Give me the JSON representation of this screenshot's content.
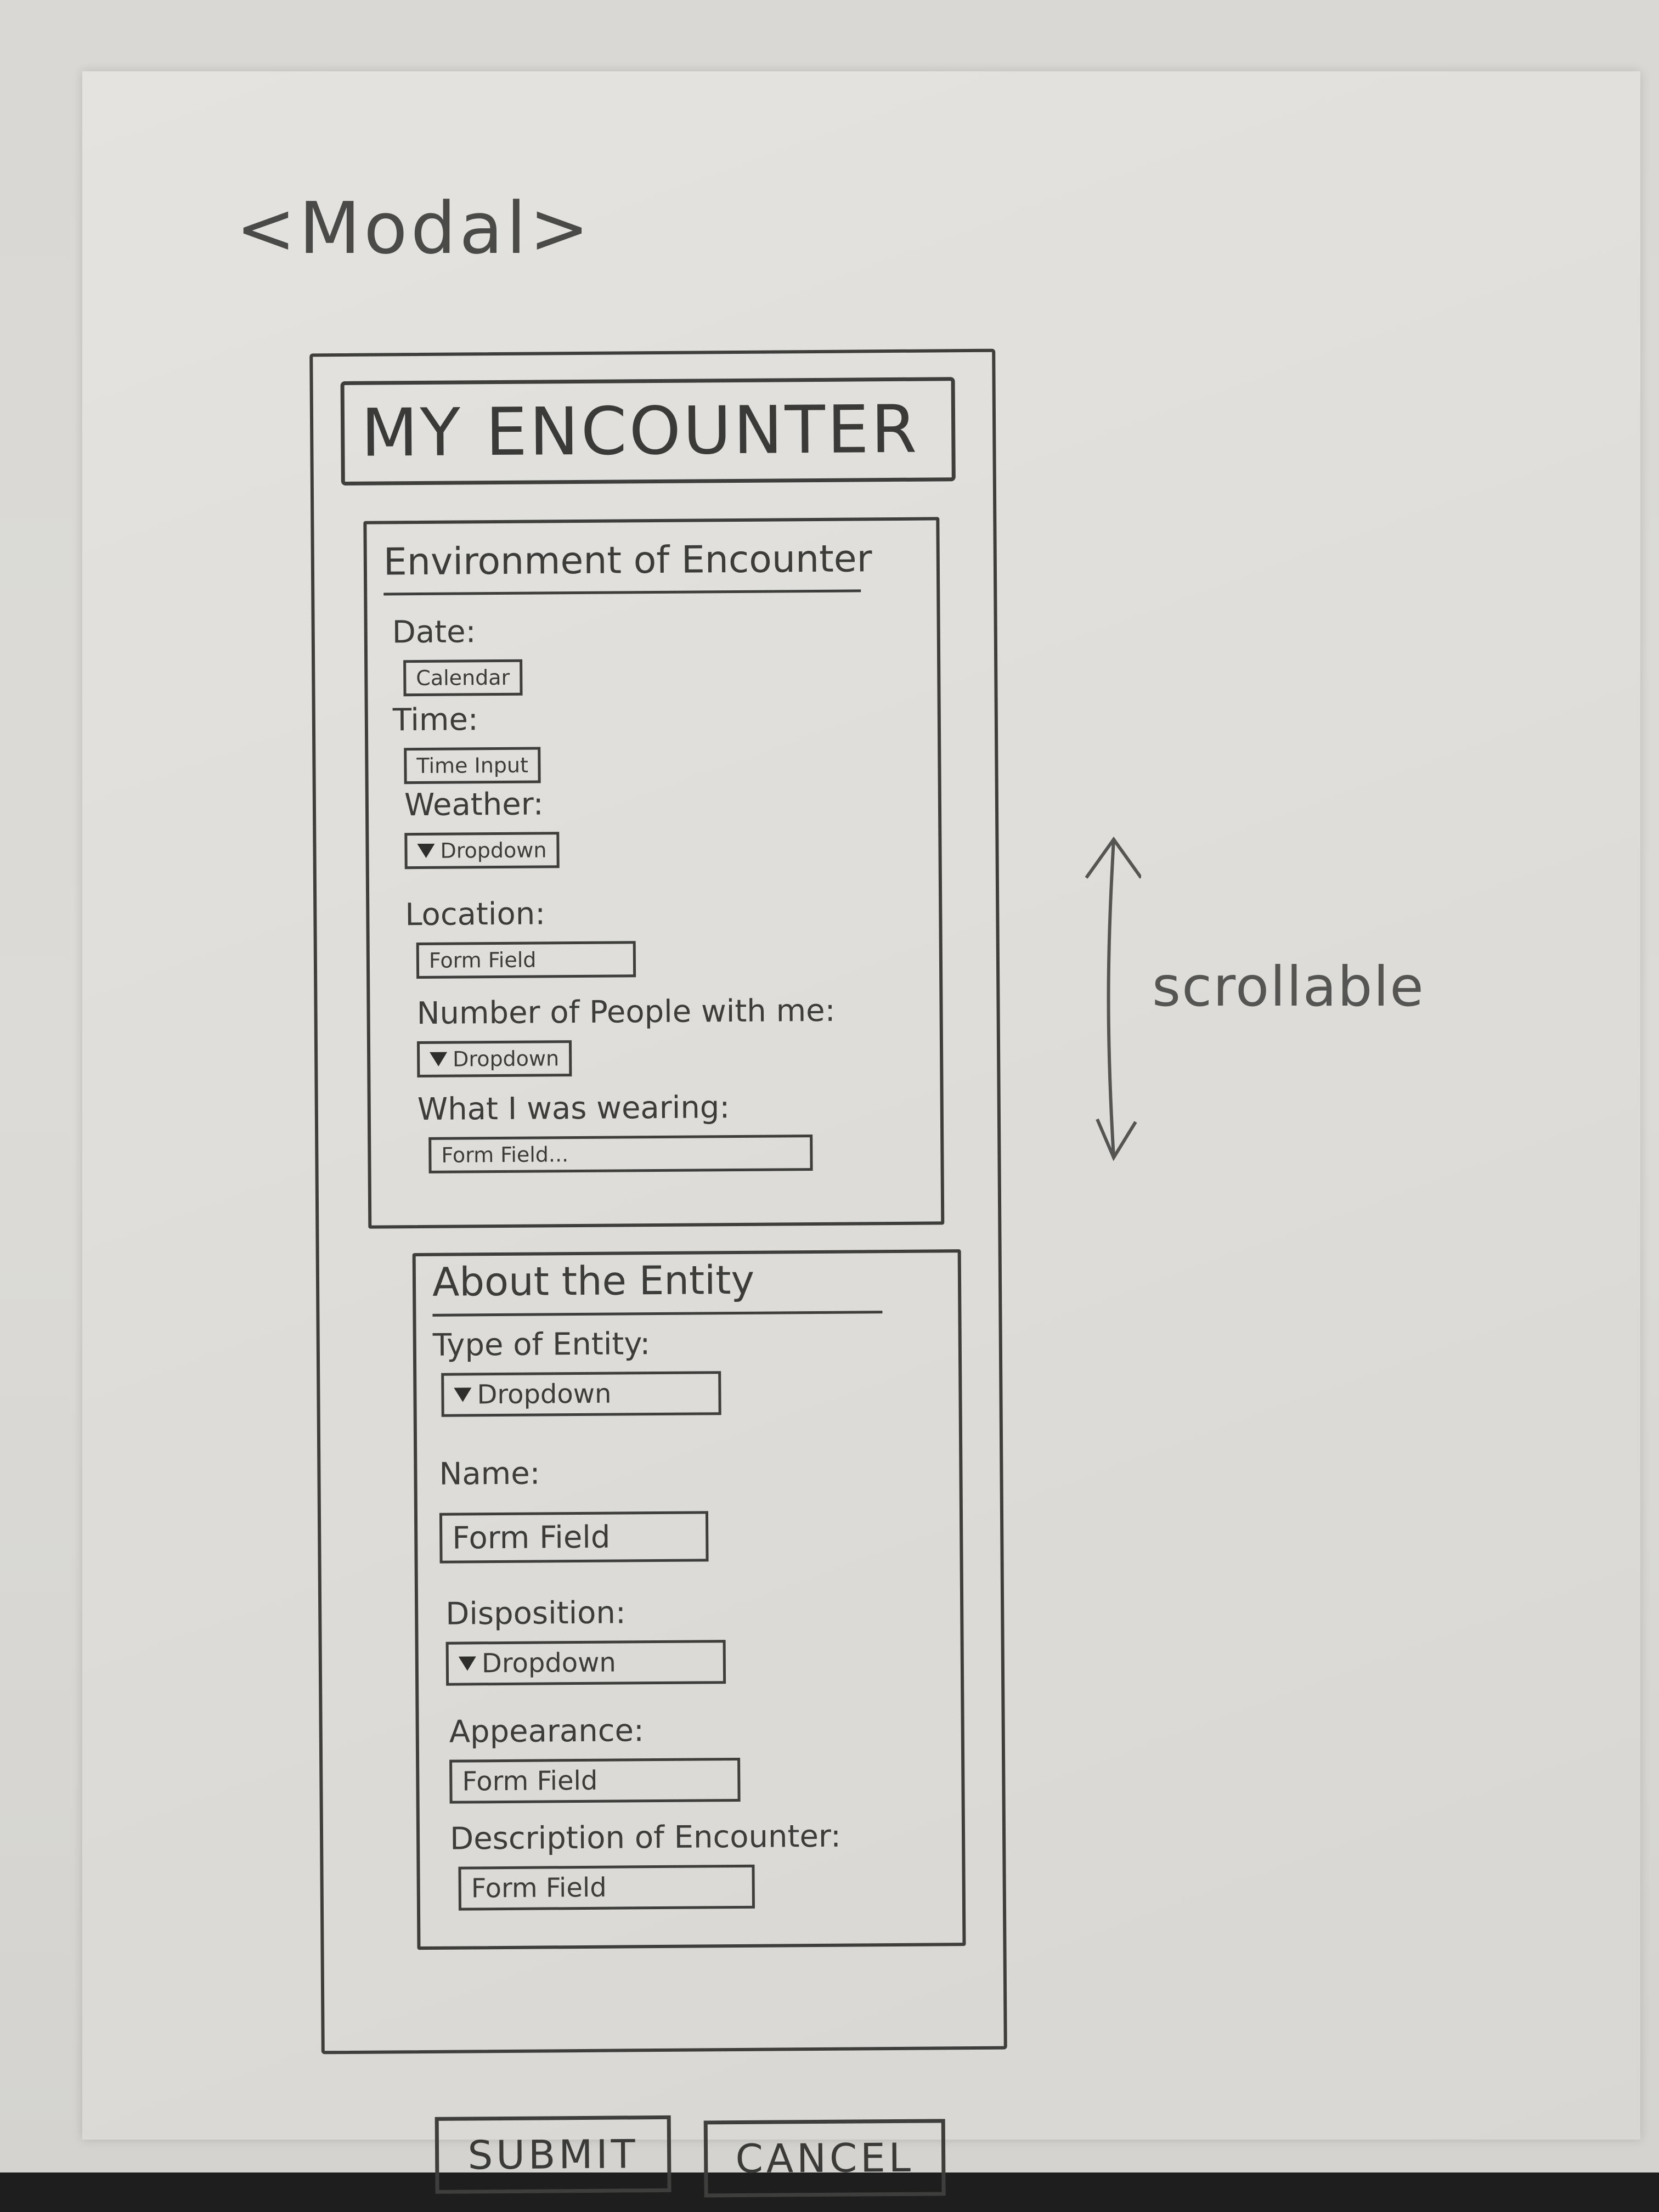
{
  "annotation": {
    "modal_tag": "<Modal>",
    "scroll_note": "scrollable",
    "scroll_icon": "double-headed-vertical-arrow"
  },
  "modal": {
    "title": "MY ENCOUNTER",
    "sections": [
      {
        "heading": "Environment of Encounter",
        "fields": [
          {
            "label": "Date:",
            "control_type": "calendar",
            "placeholder": "Calendar"
          },
          {
            "label": "Time:",
            "control_type": "time",
            "placeholder": "Time Input"
          },
          {
            "label": "Weather:",
            "control_type": "dropdown",
            "placeholder": "Dropdown"
          },
          {
            "label": "Location:",
            "control_type": "text",
            "placeholder": "Form Field"
          },
          {
            "label": "Number of People with me:",
            "control_type": "dropdown",
            "placeholder": "Dropdown"
          },
          {
            "label": "What I was wearing:",
            "control_type": "text",
            "placeholder": "Form Field..."
          }
        ]
      },
      {
        "heading": "About the Entity",
        "fields": [
          {
            "label": "Type of Entity:",
            "control_type": "dropdown",
            "placeholder": "Dropdown"
          },
          {
            "label": "Name:",
            "control_type": "text",
            "placeholder": "Form Field"
          },
          {
            "label": "Disposition:",
            "control_type": "dropdown",
            "placeholder": "Dropdown"
          },
          {
            "label": "Appearance:",
            "control_type": "text",
            "placeholder": "Form Field"
          },
          {
            "label": "Description of Encounter:",
            "control_type": "text",
            "placeholder": "Form Field"
          }
        ]
      }
    ],
    "buttons": {
      "submit": "SUBMIT",
      "cancel": "CANCEL"
    }
  },
  "icons": {
    "dropdown": "triangle-down-icon"
  }
}
